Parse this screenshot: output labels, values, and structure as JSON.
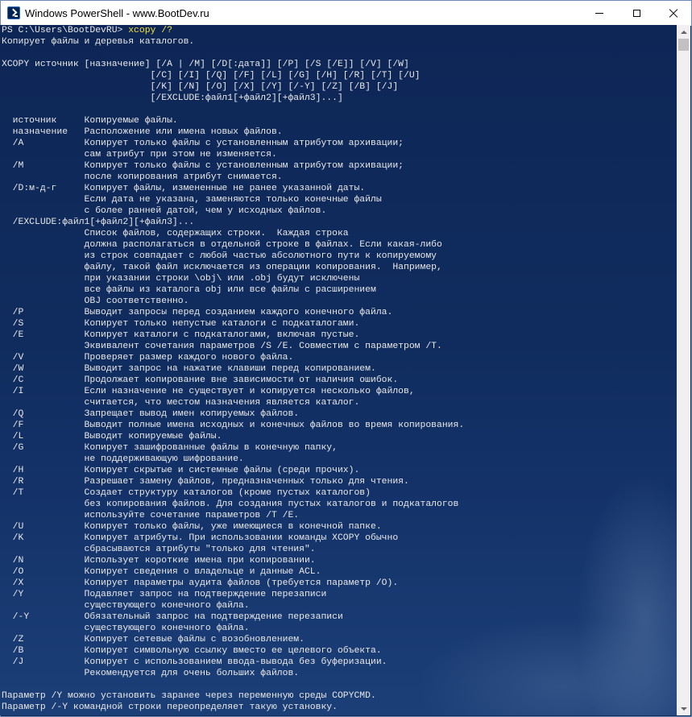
{
  "window": {
    "title": "Windows PowerShell - www.BootDev.ru"
  },
  "console": {
    "prompt": "PS C:\\Users\\BootDevRU> ",
    "command": "xcopy /?",
    "output": "Копирует файлы и деревья каталогов.\n\nXCOPY источник [назначение] [/A | /M] [/D[:дата]] [/P] [/S [/E]] [/V] [/W]\n                           [/C] [/I] [/Q] [/F] [/L] [/G] [/H] [/R] [/T] [/U]\n                           [/K] [/N] [/O] [/X] [/Y] [/-Y] [/Z] [/B] [/J]\n                           [/EXCLUDE:файл1[+файл2][+файл3]...]\n\n  источник     Копируемые файлы.\n  назначение   Расположение или имена новых файлов.\n  /A           Копирует только файлы с установленным атрибутом архивации;\n               сам атрибут при этом не изменяется.\n  /M           Копирует только файлы с установленным атрибутом архивации;\n               после копирования атрибут снимается.\n  /D:м-д-г     Копирует файлы, измененные не ранее указанной даты.\n               Если дата не указана, заменяются только конечные файлы\n               с более ранней датой, чем у исходных файлов.\n  /EXCLUDE:файл1[+файл2][+файл3]...\n               Список файлов, содержащих строки.  Каждая строка\n               должна располагаться в отдельной строке в файлах. Если какая-либо\n               из строк совпадает с любой частью абсолютного пути к копируемому\n               файлу, такой файл исключается из операции копирования.  Например,\n               при указании строки \\obj\\ или .obj будут исключены\n               все файлы из каталога obj или все файлы с расширением\n               OBJ соответственно.\n  /P           Выводит запросы перед созданием каждого конечного файла.\n  /S           Копирует только непустые каталоги с подкаталогами.\n  /E           Копирует каталоги с подкаталогами, включая пустые.\n               Эквивалент сочетания параметров /S /E. Совместим с параметром /T.\n  /V           Проверяет размер каждого нового файла.\n  /W           Выводит запрос на нажатие клавиши перед копированием.\n  /C           Продолжает копирование вне зависимости от наличия ошибок.\n  /I           Если назначение не существует и копируется несколько файлов,\n               считается, что местом назначения является каталог.\n  /Q           Запрещает вывод имен копируемых файлов.\n  /F           Выводит полные имена исходных и конечных файлов во время копирования.\n  /L           Выводит копируемые файлы.\n  /G           Копирует зашифрованные файлы в конечную папку,\n               не поддерживающую шифрование.\n  /H           Копирует скрытые и системные файлы (среди прочих).\n  /R           Разрешает замену файлов, предназначенных только для чтения.\n  /T           Создает структуру каталогов (кроме пустых каталогов)\n               без копирования файлов. Для создания пустых каталогов и подкаталогов\n               используйте сочетание параметров /T /E.\n  /U           Копирует только файлы, уже имеющиеся в конечной папке.\n  /K           Копирует атрибуты. При использовании команды XCOPY обычно\n               сбрасываются атрибуты \"только для чтения\".\n  /N           Использует короткие имена при копировании.\n  /O           Копирует сведения о владельце и данные ACL.\n  /X           Копирует параметры аудита файлов (требуется параметр /O).\n  /Y           Подавляет запрос на подтверждение перезаписи\n               существующего конечного файла.\n  /-Y          Обязательный запрос на подтверждение перезаписи\n               существующего конечного файла.\n  /Z           Копирует сетевые файлы с возобновлением.\n  /B           Копирует символьную ссылку вместо ее целевого объекта.\n  /J           Копирует с использованием ввода-вывода без буферизации.\n               Рекомендуется для очень больших файлов.\n\nПараметр /Y можно установить заранее через переменную среды COPYCMD.\nПараметр /-Y командной строки переопределяет такую установку."
  },
  "icons": {
    "app": "powershell-icon",
    "minimize": "minimize-icon",
    "maximize": "maximize-icon",
    "close": "close-icon"
  },
  "colors": {
    "command": "#f0e040",
    "text": "#e8e8e8",
    "background": "#0f2a5a"
  }
}
